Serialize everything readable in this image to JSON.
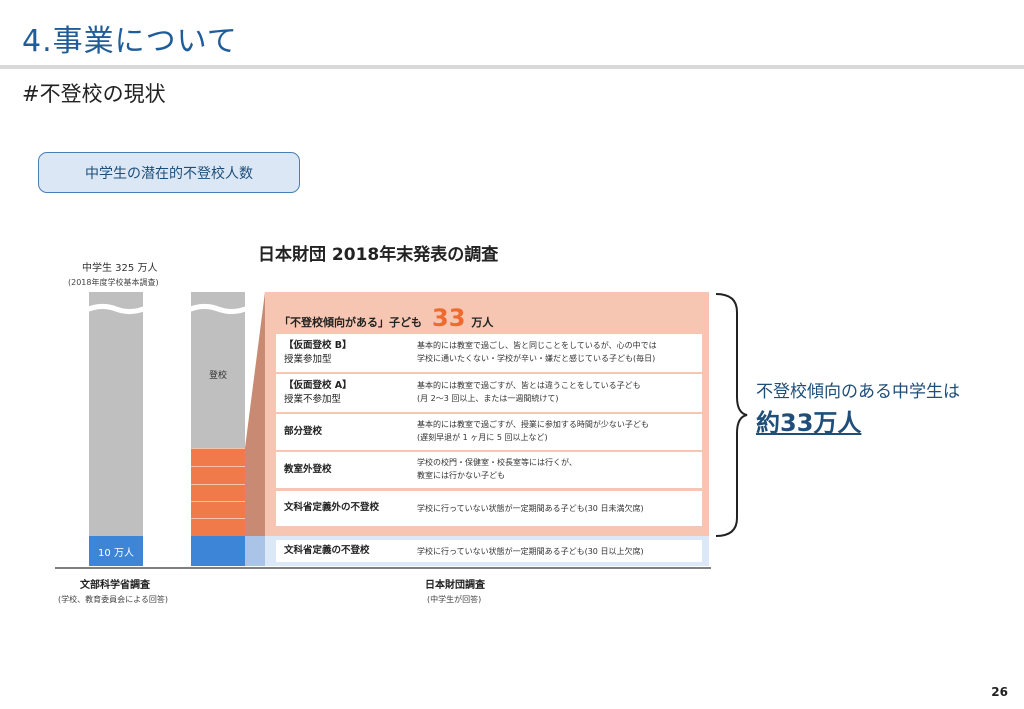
{
  "header": {
    "title": "4.事業について",
    "subtitle": "#不登校の現状",
    "pill_label": "中学生の潜在的不登校人数"
  },
  "figure": {
    "survey_title": "日本財団 2018年末発表の調査",
    "left_column": {
      "total_label": "中学生 325 万人",
      "total_source": "(2018年度学校基本調査)",
      "official_count": "10 万人",
      "footer_title": "文部科学省調査",
      "footer_note": "(学校、教育委員会による回答)"
    },
    "right_column": {
      "attend_label": "登校",
      "footer_title": "日本財団調査",
      "footer_note": "(中学生が回答)"
    },
    "panel": {
      "heading_prefix": "「不登校傾向がある」子ども",
      "heading_number": "33",
      "heading_suffix": "万人",
      "rows": [
        {
          "label_1": "【仮面登校 B】",
          "label_2": "授業参加型",
          "desc_1": "基本的には教室で過ごし、皆と同じことをしているが、心の中では",
          "desc_2": "学校に通いたくない・学校が辛い・嫌だと感じている子ども(毎日)"
        },
        {
          "label_1": "【仮面登校 A】",
          "label_2": "授業不参加型",
          "desc_1": "基本的には教室で過ごすが、皆とは違うことをしている子ども",
          "desc_2": "(月 2〜3 回以上、または一週間続けて)"
        },
        {
          "label_1": "部分登校",
          "label_2": "",
          "desc_1": "基本的には教室で過ごすが、授業に参加する時間が少ない子ども",
          "desc_2": "(遅刻早退が 1 ヶ月に 5 回以上など)"
        },
        {
          "label_1": "教室外登校",
          "label_2": "",
          "desc_1": "学校の校門・保健室・校長室等には行くが、",
          "desc_2": "教室には行かない子ども"
        },
        {
          "label_1": "文科省定義外の不登校",
          "label_2": "",
          "desc_1": "学校に行っていない状態が一定期間ある子ども(30 日未満欠席)",
          "desc_2": ""
        }
      ],
      "official_row": {
        "label": "文科省定義の不登校",
        "desc": "学校に行っていない状態が一定期間ある子ども(30 日以上欠席)"
      }
    }
  },
  "callout": {
    "text": "不登校傾向のある中学生は",
    "emphasis": "約33万人"
  },
  "page_number": "26",
  "colors": {
    "title_blue": "#1f5c99",
    "orange": "#f07a4a",
    "salmon_panel": "#f6c6b2",
    "blue_bar": "#3d85d6",
    "gray_bar": "#bfbfbf"
  }
}
